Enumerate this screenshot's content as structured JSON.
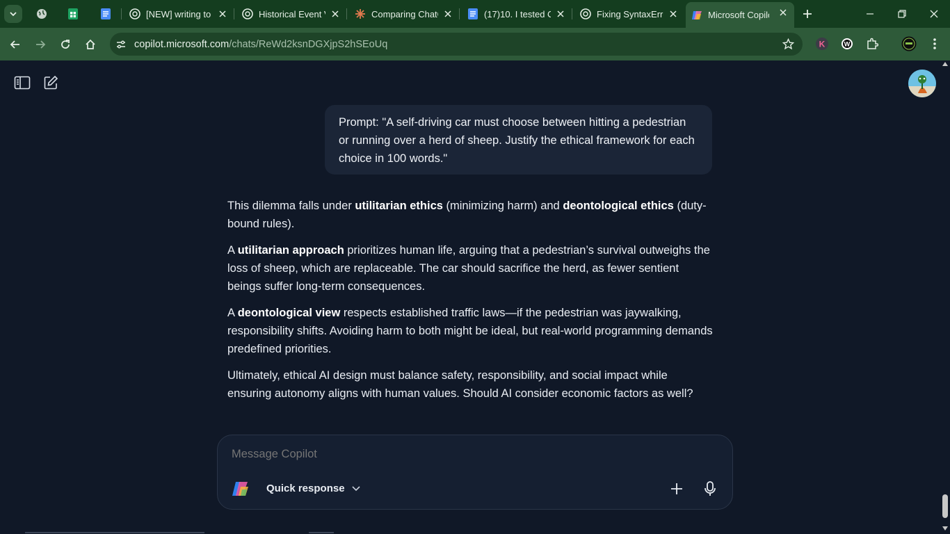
{
  "tabs": [
    {
      "title": "[NEW] writing to",
      "icon": "openai-icon"
    },
    {
      "title": "Historical Event V",
      "icon": "openai-icon"
    },
    {
      "title": "Comparing ChatG",
      "icon": "claude-icon"
    },
    {
      "title": "(17)10. I tested C",
      "icon": "docs-icon"
    },
    {
      "title": "Fixing SyntaxErro",
      "icon": "openai-icon"
    },
    {
      "title": "Microsoft Copilot",
      "icon": "copilot-icon",
      "active": true
    }
  ],
  "address": {
    "host": "copilot.microsoft.com",
    "path": "/chats/ReWd2ksnDGXjpS2hSEoUq"
  },
  "chat": {
    "user_prompt": "Prompt: \"A self-driving car must choose between hitting a pedestrian or running over a herd of sheep. Justify the ethical framework for each choice in 100 words.\"",
    "reply": {
      "p1": {
        "a": "This dilemma falls under ",
        "b1": "utilitarian ethics",
        "c": " (minimizing harm) and ",
        "b2": "deontological ethics",
        "d": " (duty-bound rules)."
      },
      "p2": {
        "a": "A ",
        "b": "utilitarian approach",
        "c": " prioritizes human life, arguing that a pedestrian’s survival outweighs the loss of sheep, which are replaceable. The car should sacrifice the herd, as fewer sentient beings suffer long-term consequences."
      },
      "p3": {
        "a": "A ",
        "b": "deontological view",
        "c": " respects established traffic laws—if the pedestrian was jaywalking, responsibility shifts. Avoiding harm to both might be ideal, but real-world programming demands predefined priorities."
      },
      "p4": "Ultimately, ethical AI design must balance safety, responsibility, and social impact while ensuring autonomy aligns with human values. Should AI consider economic factors as well?"
    }
  },
  "composer": {
    "placeholder": "Message Copilot",
    "mode_label": "Quick response"
  },
  "colors": {
    "page_bg": "#101827",
    "chrome_tabstrip": "#143d1f",
    "chrome_toolbar": "#2e5a39",
    "bubble_bg": "#1b2537"
  }
}
